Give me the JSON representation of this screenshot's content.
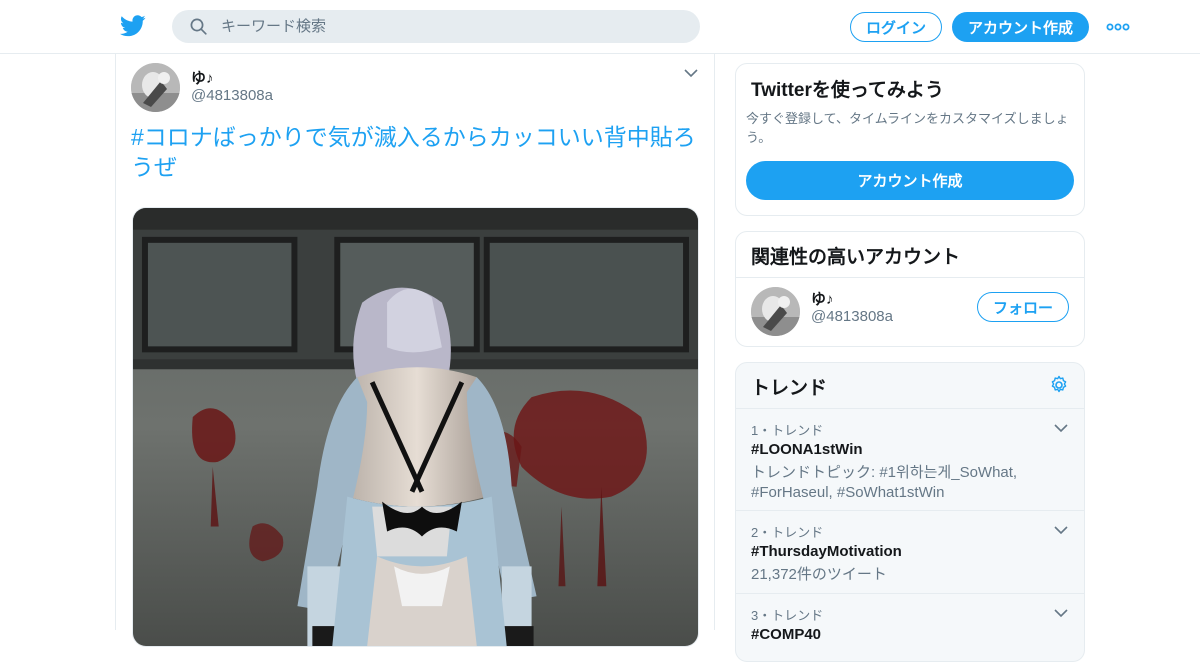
{
  "colors": {
    "accent": "#1da1f2",
    "text": "#14171a",
    "muted": "#657786",
    "border": "#e6ecf0",
    "panel_bg": "#f5f8fa"
  },
  "header": {
    "logo_icon": "twitter-bird-icon",
    "search": {
      "icon": "search-icon",
      "placeholder": "キーワード検索"
    },
    "login_label": "ログイン",
    "signup_label": "アカウント作成",
    "more_icon": "more-dots-icon"
  },
  "tweet": {
    "user": {
      "name": "ゆ♪",
      "handle": "@4813808a"
    },
    "text": "#コロナばっかりで気が滅入るからカッコいい背中貼ろうぜ",
    "caret_icon": "chevron-down-icon",
    "media_icon": "photo"
  },
  "signup_card": {
    "title": "Twitterを使ってみよう",
    "description": "今すぐ登録して、タイムラインをカスタマイズしましょう。",
    "button_label": "アカウント作成"
  },
  "related_card": {
    "title": "関連性の高いアカウント",
    "account": {
      "name": "ゆ♪",
      "handle": "@4813808a"
    },
    "follow_label": "フォロー"
  },
  "trends_card": {
    "title": "トレンド",
    "settings_icon": "gear-icon",
    "items": [
      {
        "meta": "1・トレンド",
        "name": "#LOONA1stWin",
        "detail": "トレンドトピック: #1위하는게_SoWhat, #ForHaseul, #SoWhat1stWin"
      },
      {
        "meta": "2・トレンド",
        "name": "#ThursdayMotivation",
        "detail": "21,372件のツイート"
      },
      {
        "meta": "3・トレンド",
        "name": "#COMP40",
        "detail": ""
      }
    ]
  }
}
